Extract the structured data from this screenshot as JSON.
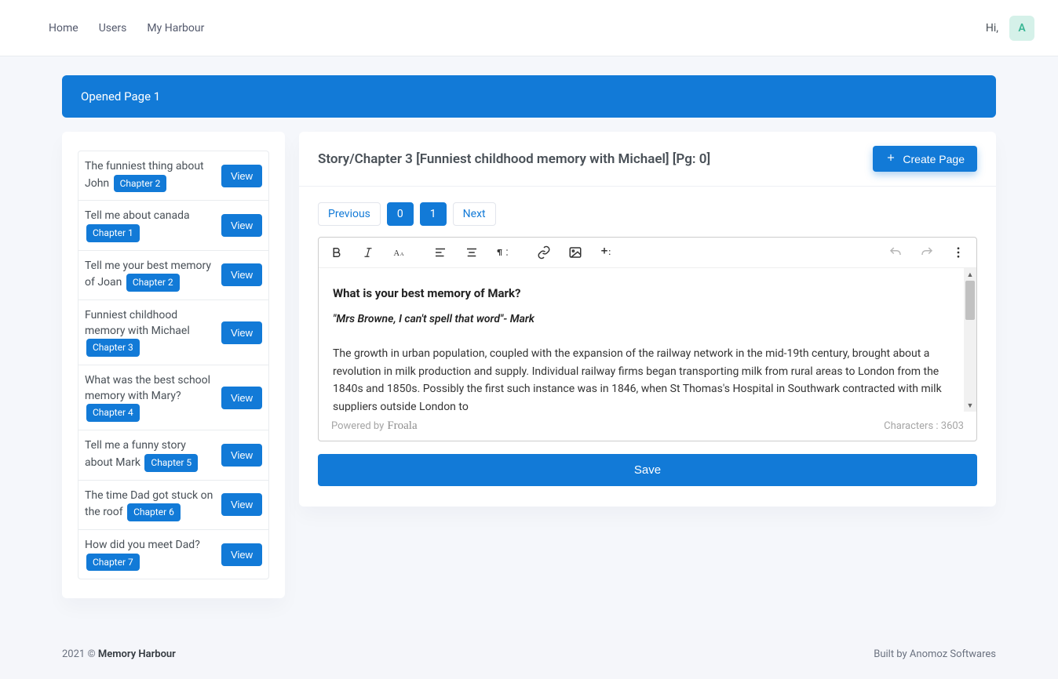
{
  "nav": {
    "home": "Home",
    "users": "Users",
    "myharbour": "My Harbour",
    "greeting": "Hi,",
    "avatar_initial": "A"
  },
  "banner": "Opened Page 1",
  "sidebar": {
    "items": [
      {
        "title": "The funniest thing about John",
        "chapter": "Chapter 2",
        "view": "View"
      },
      {
        "title": "Tell me about canada",
        "chapter": "Chapter 1",
        "view": "View"
      },
      {
        "title": "Tell me your best memory of Joan",
        "chapter": "Chapter 2",
        "view": "View"
      },
      {
        "title": "Funniest childhood memory with Michael",
        "chapter": "Chapter 3",
        "view": "View"
      },
      {
        "title": "What was the best school memory with Mary?",
        "chapter": "Chapter 4",
        "view": "View"
      },
      {
        "title": "Tell me a funny story about Mark",
        "chapter": "Chapter 5",
        "view": "View"
      },
      {
        "title": "The time Dad got stuck on the roof",
        "chapter": "Chapter 6",
        "view": "View"
      },
      {
        "title": "How did you meet Dad?",
        "chapter": "Chapter 7",
        "view": "View"
      }
    ]
  },
  "main": {
    "title": "Story/Chapter 3 [Funniest childhood memory with Michael] [Pg: 0]",
    "create_page": "Create Page",
    "pager": {
      "prev": "Previous",
      "p0": "0",
      "p1": "1",
      "next": "Next"
    },
    "editor": {
      "heading": "What is your best memory of Mark?",
      "quote": "\"Mrs Browne, I can't spell that word\"- Mark",
      "body": "The growth in urban population, coupled with the expansion of the railway network in the mid-19th century, brought about a revolution in milk production and supply. Individual railway firms began transporting milk from rural areas to London from the 1840s and 1850s. Possibly the first such instance was in 1846, when St Thomas's Hospital in Southwark contracted with milk suppliers outside London to",
      "powered_by": "Powered by",
      "brand": "Froala",
      "char_label": "Characters :",
      "char_count": "3603"
    },
    "save": "Save"
  },
  "footer": {
    "left_prefix": "2021 © ",
    "left_strong": "Memory Harbour",
    "right": "Built by Anomoz Softwares"
  }
}
